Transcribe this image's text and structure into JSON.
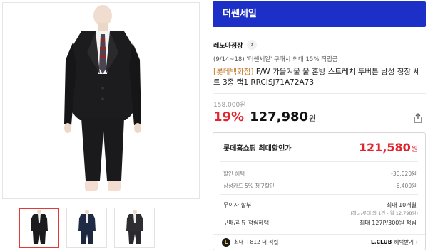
{
  "banner": {
    "label": "더쎈세일"
  },
  "store": {
    "name": "레노마정장",
    "chevron_icon": "chevron-right-icon"
  },
  "promo_note": "(9/14~18) '더쎈세일' 구매시 최대 15% 적립금",
  "product": {
    "brand_tag": "[롯데백화점]",
    "title_rest": " F/W 가을겨울 울 혼방 스트레치 투버튼 남성 정장 세트 3종 택1 RRCISJ71A72A73"
  },
  "price": {
    "original": "158,000원",
    "discount": "19%",
    "sale": "127,980",
    "won": "원",
    "share_icon": "share-icon"
  },
  "max_discount_box": {
    "label": "롯데홈쇼핑 최대할인가",
    "price": "121,580",
    "won": "원",
    "rows": [
      {
        "label": "할인 혜택",
        "value": "-30,020원"
      },
      {
        "label": "삼성카드 5% 청구할인",
        "value": "-6,400원"
      }
    ],
    "installment": {
      "label": "무이자 할부",
      "value": "최대 10개월",
      "note": "(하나/롯데 외 1건 - 월 12,798원)"
    },
    "review_points": {
      "label": "구매/리뷰 적립혜택",
      "value": "최대 127P/300원 적립"
    },
    "lclub": {
      "badge": "L",
      "left_text": "최대 +812 더 적립",
      "brand": "L.CLUB",
      "link_text": "혜택받기",
      "chevron": "›"
    }
  },
  "thumbnails": [
    {
      "label": "suit-thumbnail-black",
      "active": true
    },
    {
      "label": "suit-thumbnail-navy",
      "active": false
    },
    {
      "label": "suit-thumbnail-charcoal",
      "active": false
    }
  ],
  "colors": {
    "banner_bg": "#1c2fc6",
    "discount_red": "#e2242d",
    "brand_tag": "#c07a2a",
    "thumb_active": "#e23a3a"
  }
}
